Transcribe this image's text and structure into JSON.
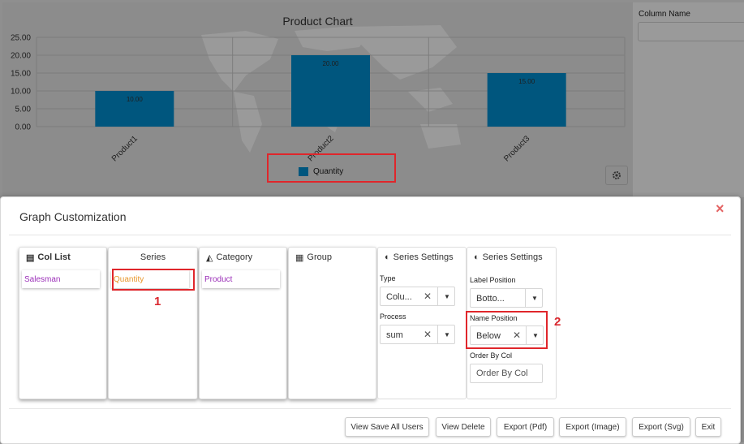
{
  "chart_data": {
    "type": "bar",
    "title": "Product Chart",
    "categories": [
      "Product1",
      "Product2",
      "Product3"
    ],
    "series": [
      {
        "name": "Quantity",
        "values": [
          10.0,
          20.0,
          15.0
        ]
      }
    ],
    "value_labels": [
      "10.00",
      "20.00",
      "15.00"
    ],
    "y_ticks": [
      "25.00",
      "20.00",
      "15.00",
      "10.00",
      "5.00",
      "0.00"
    ],
    "ylim": [
      0,
      25
    ],
    "grid": true,
    "legend_position": "bottom",
    "bar_color": "#00567e"
  },
  "right_panel": {
    "column_name_label": "Column Name"
  },
  "callouts": {
    "one": "1",
    "two": "2"
  },
  "modal": {
    "title": "Graph Customization",
    "close_icon": "×",
    "columns": {
      "col_list": {
        "header": "Col List",
        "items": [
          "Salesman"
        ]
      },
      "series": {
        "header": "Series",
        "items": [
          "Quantity"
        ]
      },
      "category": {
        "header": "Category",
        "items": [
          "Product"
        ]
      },
      "group": {
        "header": "Group",
        "items": []
      }
    },
    "series_settings_1": {
      "header": "Series Settings",
      "type_label": "Type",
      "type_value": "Colu...",
      "process_label": "Process",
      "process_value": "sum"
    },
    "series_settings_2": {
      "header": "Series Settings",
      "label_position_label": "Label Position",
      "label_position_value": "Botto...",
      "name_position_label": "Name Position",
      "name_position_value": "Below",
      "order_by_label": "Order By Col",
      "order_by_placeholder": "Order By Col"
    },
    "buttons": [
      "View Save All Users",
      "View Delete",
      "Export (Pdf)",
      "Export (Image)",
      "Export (Svg)",
      "Exit"
    ]
  },
  "colors": {
    "accent_red": "#e0262b",
    "chip_purple": "#9b2fb8",
    "chip_orange": "#e8962a",
    "bar": "#00567e"
  }
}
